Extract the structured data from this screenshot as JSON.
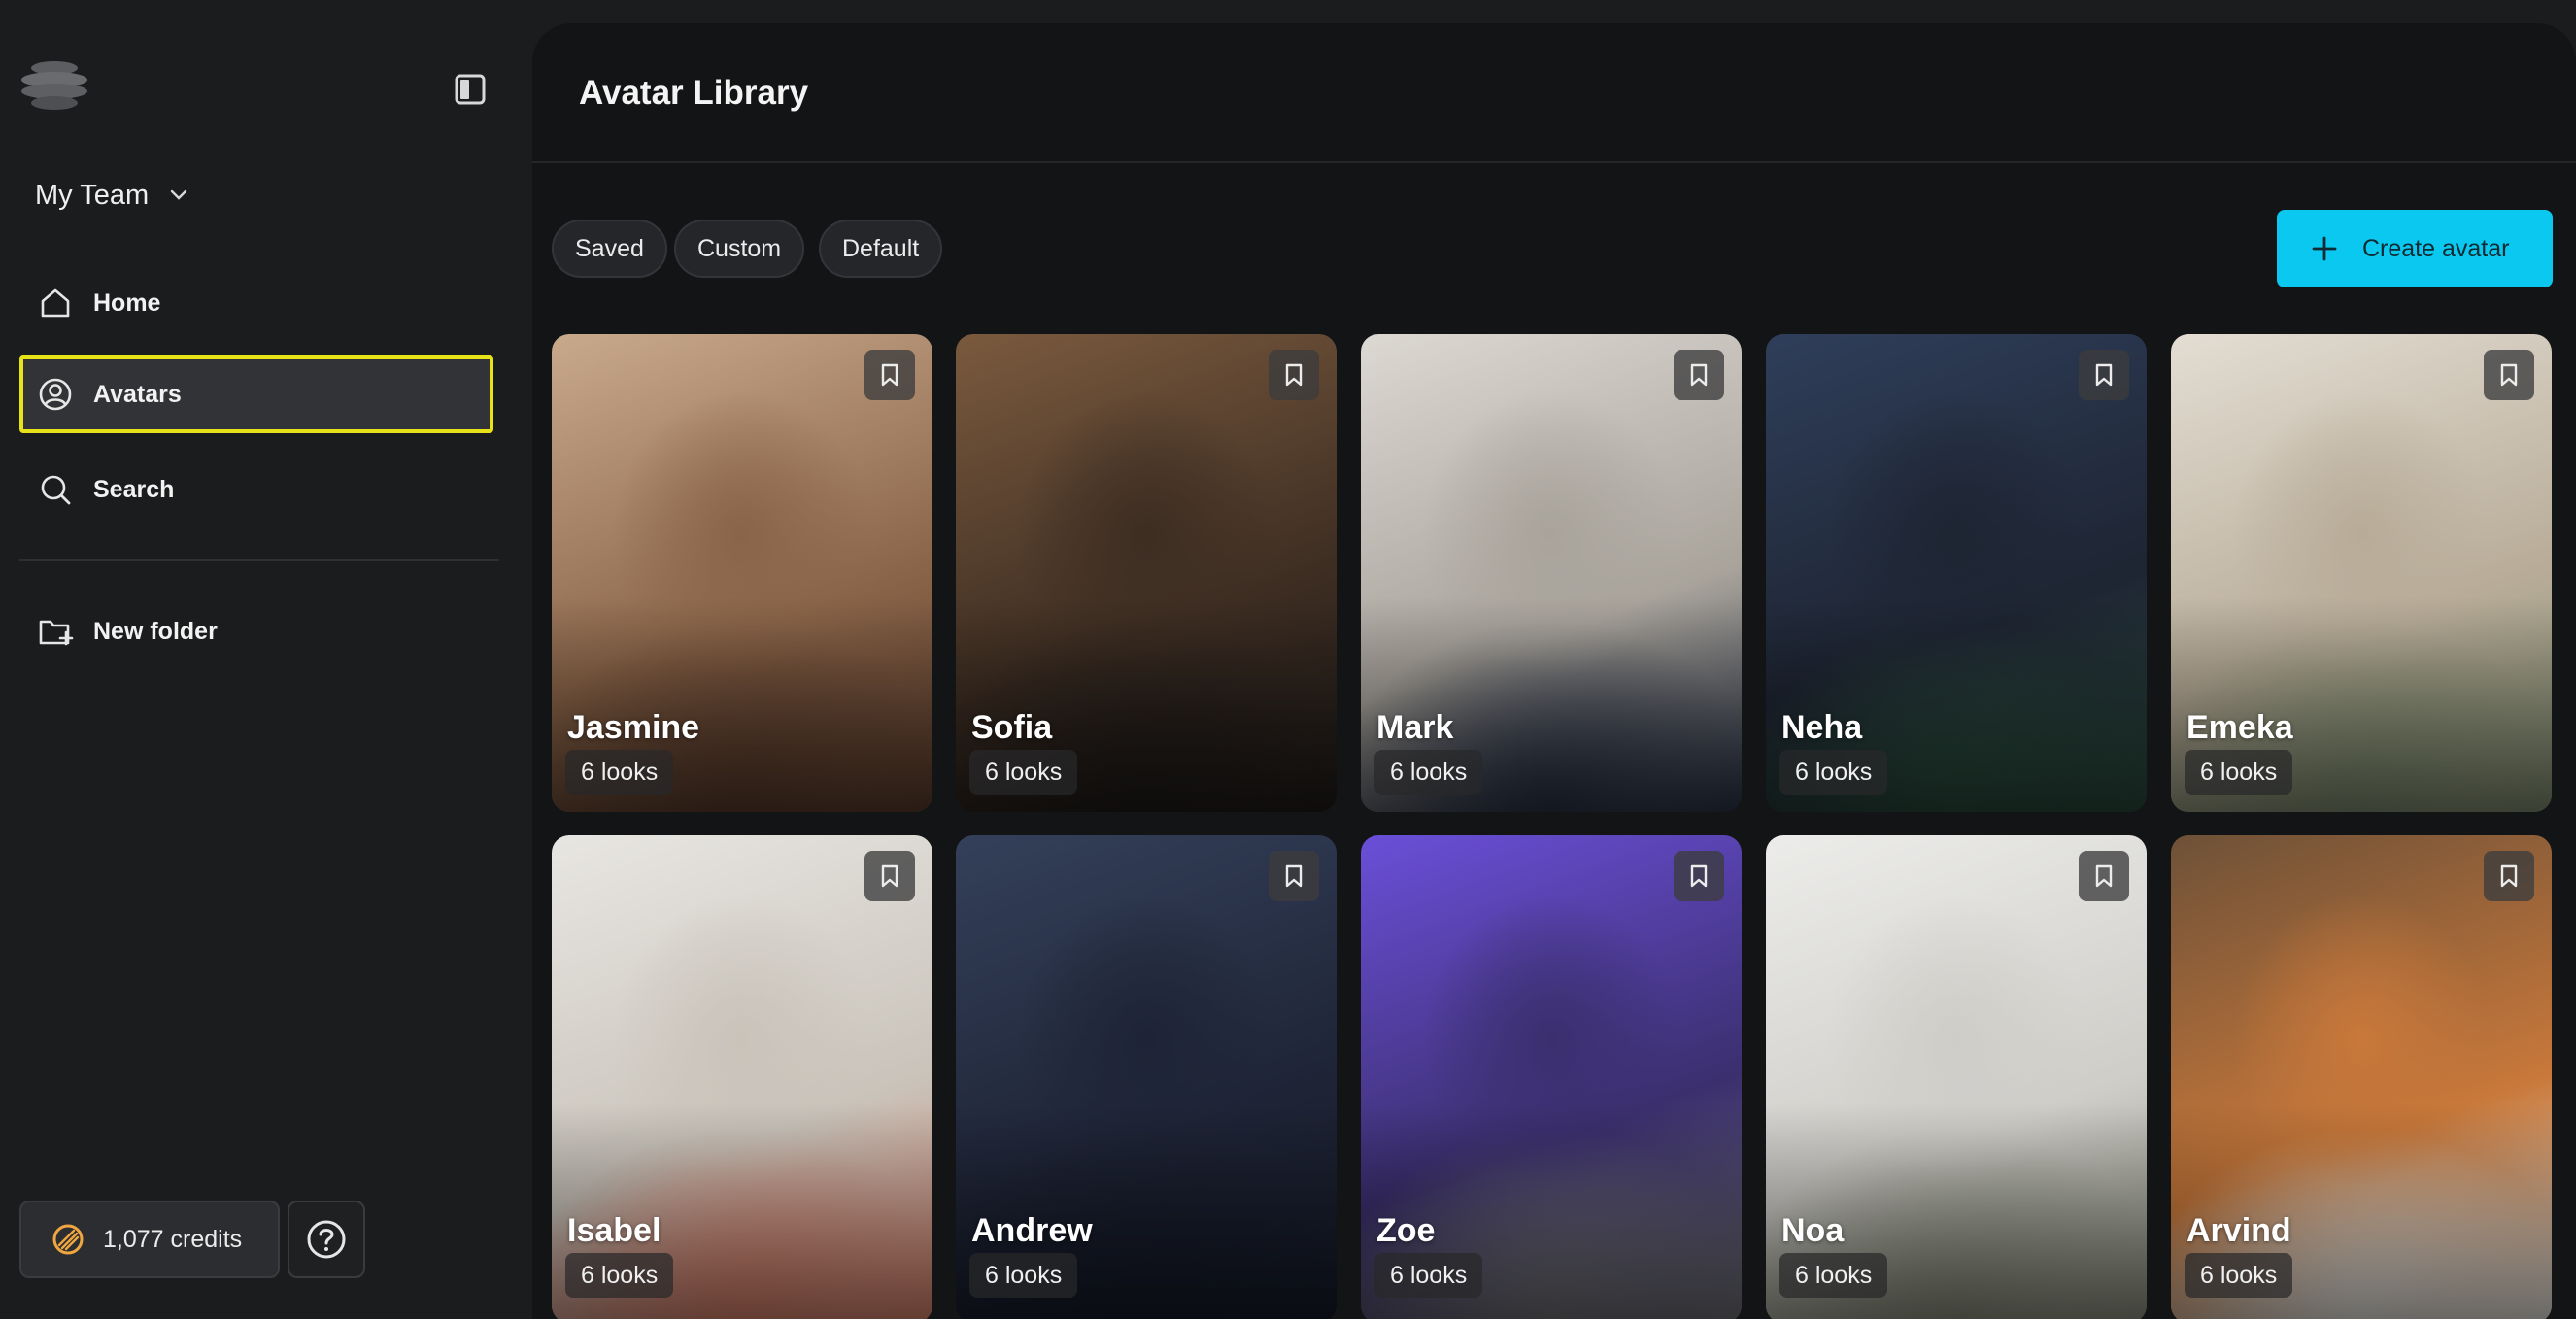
{
  "sidebar": {
    "team_label": "My Team",
    "nav": [
      {
        "label": "Home",
        "icon": "home-icon"
      },
      {
        "label": "Avatars",
        "icon": "user-circle-icon",
        "active": true
      },
      {
        "label": "Search",
        "icon": "search-icon"
      }
    ],
    "new_folder_label": "New folder",
    "credits_label": "1,077 credits"
  },
  "main": {
    "title": "Avatar Library",
    "filters": [
      "Saved",
      "Custom",
      "Default"
    ],
    "create_label": "Create avatar",
    "avatars": [
      {
        "name": "Jasmine",
        "looks": "6 looks",
        "bg": [
          "#c9a98c",
          "#8a6448",
          "#5a3c2c"
        ]
      },
      {
        "name": "Sofia",
        "looks": "6 looks",
        "bg": [
          "#7a5a3e",
          "#3d2d22",
          "#1f1b19"
        ]
      },
      {
        "name": "Mark",
        "looks": "6 looks",
        "bg": [
          "#dcd8d2",
          "#a8a39b",
          "#2a3347"
        ]
      },
      {
        "name": "Neha",
        "looks": "6 looks",
        "bg": [
          "#2f3e5a",
          "#1e2533",
          "#2a4a3c"
        ]
      },
      {
        "name": "Emeka",
        "looks": "6 looks",
        "bg": [
          "#e3ddd3",
          "#b8ac98",
          "#7f8c70"
        ]
      },
      {
        "name": "Isabel",
        "looks": "6 looks",
        "bg": [
          "#e8e6e2",
          "#c9c3ba",
          "#d9826c"
        ]
      },
      {
        "name": "Andrew",
        "looks": "6 looks",
        "bg": [
          "#34405a",
          "#1e2436",
          "#151a28"
        ]
      },
      {
        "name": "Zoe",
        "looks": "6 looks",
        "bg": [
          "#6a4fd8",
          "#3b2f6e",
          "#6f7075"
        ]
      },
      {
        "name": "Noa",
        "looks": "6 looks",
        "bg": [
          "#ececea",
          "#cfcdc8",
          "#8b8f7e"
        ]
      },
      {
        "name": "Arvind",
        "looks": "6 looks",
        "bg": [
          "#6e5138",
          "#c8783a",
          "#e9e7e2"
        ]
      }
    ]
  },
  "colors": {
    "accent": "#0ac8ef",
    "active_outline": "#e8e218",
    "credits_icon": "#f0a640"
  }
}
